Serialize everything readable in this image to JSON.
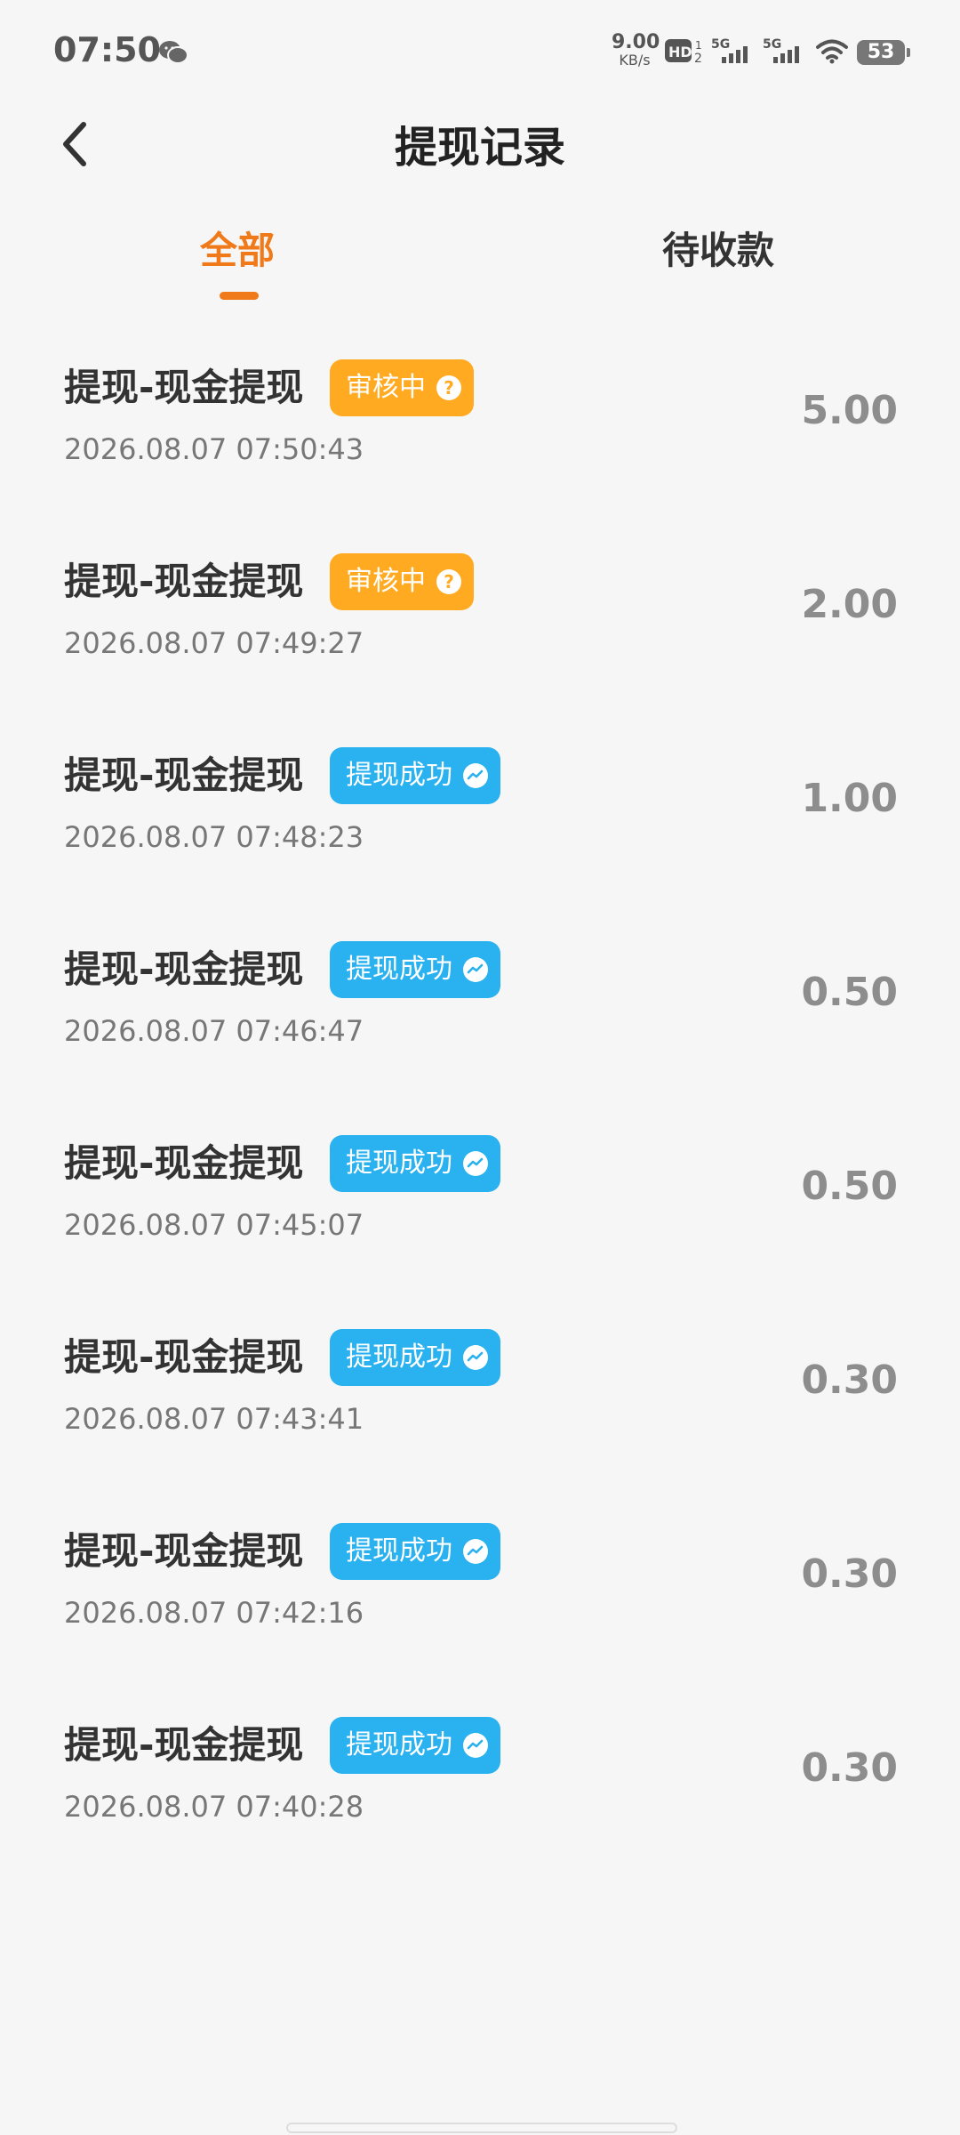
{
  "status_bar": {
    "time": "07:50",
    "net_speed_value": "9.00",
    "net_speed_unit": "KB/s",
    "battery": "53",
    "icons": [
      "wechat-icon",
      "hd-icon",
      "5g-signal-icon",
      "5g-signal-icon",
      "wifi-icon",
      "battery-icon"
    ]
  },
  "header": {
    "title": "提现记录",
    "back_icon": "chevron-left-icon"
  },
  "tabs": [
    {
      "label": "全部",
      "active": true
    },
    {
      "label": "待收款",
      "active": false
    }
  ],
  "colors": {
    "accent": "#f07a1a",
    "review_badge": "#ffaa21",
    "success_badge": "#29b1f0",
    "amount": "#8d8d8d"
  },
  "records": [
    {
      "title": "提现-现金提现",
      "status": "审核中",
      "status_type": "review",
      "status_icon": "?",
      "time": "2026.08.07 07:50:43",
      "amount": "5.00"
    },
    {
      "title": "提现-现金提现",
      "status": "审核中",
      "status_type": "review",
      "status_icon": "?",
      "time": "2026.08.07 07:49:27",
      "amount": "2.00"
    },
    {
      "title": "提现-现金提现",
      "status": "提现成功",
      "status_type": "success",
      "status_icon": "chat-bubble-icon",
      "time": "2026.08.07 07:48:23",
      "amount": "1.00"
    },
    {
      "title": "提现-现金提现",
      "status": "提现成功",
      "status_type": "success",
      "status_icon": "chat-bubble-icon",
      "time": "2026.08.07 07:46:47",
      "amount": "0.50"
    },
    {
      "title": "提现-现金提现",
      "status": "提现成功",
      "status_type": "success",
      "status_icon": "chat-bubble-icon",
      "time": "2026.08.07 07:45:07",
      "amount": "0.50"
    },
    {
      "title": "提现-现金提现",
      "status": "提现成功",
      "status_type": "success",
      "status_icon": "chat-bubble-icon",
      "time": "2026.08.07 07:43:41",
      "amount": "0.30"
    },
    {
      "title": "提现-现金提现",
      "status": "提现成功",
      "status_type": "success",
      "status_icon": "chat-bubble-icon",
      "time": "2026.08.07 07:42:16",
      "amount": "0.30"
    },
    {
      "title": "提现-现金提现",
      "status": "提现成功",
      "status_type": "success",
      "status_icon": "chat-bubble-icon",
      "time": "2026.08.07 07:40:28",
      "amount": "0.30"
    }
  ]
}
